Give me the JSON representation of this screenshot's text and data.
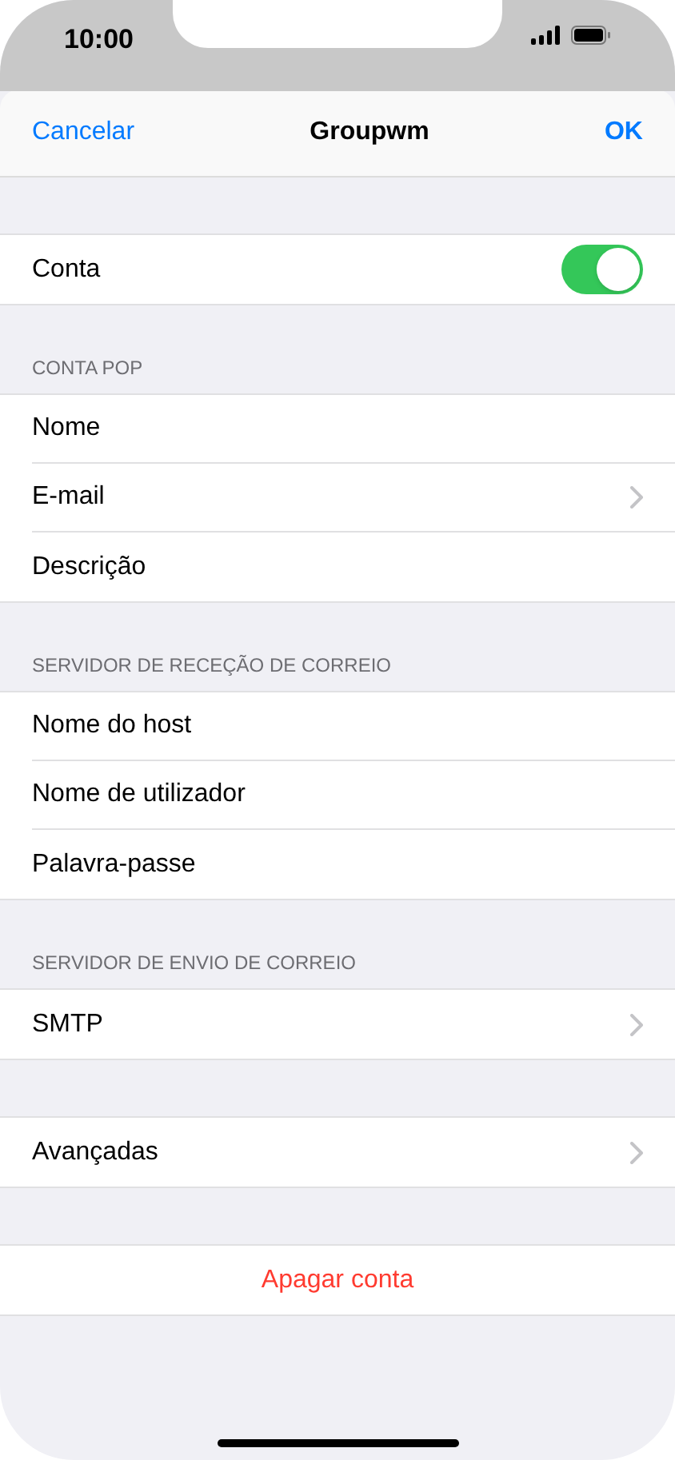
{
  "status_bar": {
    "time": "10:00"
  },
  "nav_bar": {
    "cancel": "Cancelar",
    "title": "Groupwm",
    "confirm": "OK"
  },
  "sections": [
    {
      "rows": [
        {
          "kind": "toggle",
          "label": "Conta",
          "on": true
        }
      ]
    },
    {
      "header": "CONTA POP",
      "rows": [
        {
          "kind": "text",
          "label": "Nome"
        },
        {
          "kind": "disclosure",
          "label": "E-mail"
        },
        {
          "kind": "text",
          "label": "Descrição"
        }
      ]
    },
    {
      "header": "SERVIDOR DE RECEÇÃO DE CORREIO",
      "rows": [
        {
          "kind": "text",
          "label": "Nome do host"
        },
        {
          "kind": "text",
          "label": "Nome de utilizador"
        },
        {
          "kind": "text",
          "label": "Palavra-passe"
        }
      ]
    },
    {
      "header": "SERVIDOR DE ENVIO DE CORREIO",
      "rows": [
        {
          "kind": "disclosure",
          "label": "SMTP"
        }
      ]
    },
    {
      "rows": [
        {
          "kind": "disclosure",
          "label": "Avançadas"
        }
      ]
    },
    {
      "rows": [
        {
          "kind": "destructive",
          "label": "Apagar conta"
        }
      ]
    }
  ]
}
